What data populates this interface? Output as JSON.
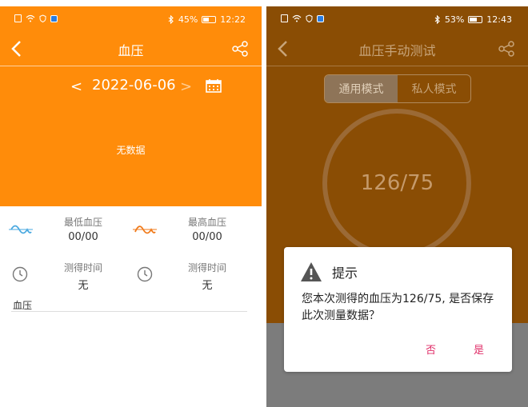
{
  "left": {
    "status_bar": {
      "battery": "45%",
      "time": "12:22"
    },
    "title": "血压",
    "date": "2022-06-06",
    "prev_label": "<",
    "next_label": ">",
    "no_data": "无数据",
    "stats": [
      {
        "label": "最低血压",
        "value": "00/00"
      },
      {
        "label": "最高血压",
        "value": "00/00"
      },
      {
        "label": "测得时间",
        "value": "无"
      },
      {
        "label": "测得时间",
        "value": "无"
      }
    ],
    "section_label": "血压"
  },
  "right": {
    "status_bar": {
      "battery": "53%",
      "time": "12:43"
    },
    "title": "血压手动测试",
    "modes": [
      "通用模式",
      "私人模式"
    ],
    "active_mode": "通用模式",
    "reading": "126/75",
    "dialog": {
      "title": "提示",
      "message": "您本次测得的血压为126/75, 是否保存此次测量数据？",
      "no_label": "否",
      "yes_label": "是"
    }
  },
  "colors": {
    "orange": "#ff8c0a",
    "accent": "#e0306a",
    "blue_wave": "#4aa9e0",
    "orange_wave": "#f07a1a"
  },
  "icons": [
    "back-icon",
    "share-icon",
    "calendar-icon",
    "wave-low-icon",
    "wave-high-icon",
    "clock-icon",
    "warning-icon",
    "bluetooth-icon",
    "wifi-icon",
    "battery-icon"
  ]
}
